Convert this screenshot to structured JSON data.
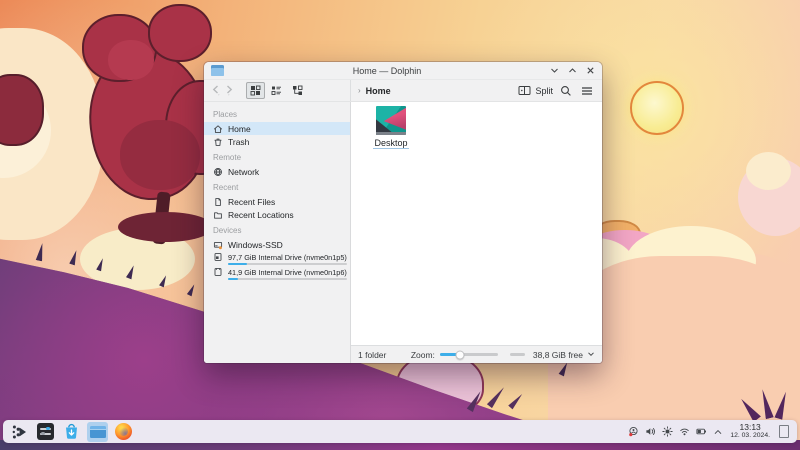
{
  "colors": {
    "accent": "#3daee9",
    "selection_bg": "#d3e7f8",
    "window_chrome": "#f1f1f2",
    "panel_bg": "#ebe8f2",
    "sky_orange": "#ec8a58",
    "hill_purple": "#6c3b78",
    "tree_red": "#a93247"
  },
  "window": {
    "title": "Home — Dolphin",
    "controls": [
      {
        "name": "minimize",
        "glyph": "chevron-down"
      },
      {
        "name": "maximize",
        "glyph": "chevron-up"
      },
      {
        "name": "close",
        "glyph": "x"
      }
    ],
    "toolbar": {
      "back_label": "back",
      "forward_label": "forward",
      "view_modes": [
        "icons-view",
        "details-view",
        "tree-view"
      ],
      "breadcrumb_sep": "›",
      "breadcrumb": "Home",
      "split_label": "Split"
    },
    "sidebar": {
      "sections": [
        {
          "label": "Places",
          "items": [
            {
              "label": "Home",
              "icon": "home-icon",
              "selected": true
            },
            {
              "label": "Trash",
              "icon": "trash-icon"
            }
          ]
        },
        {
          "label": "Remote",
          "items": [
            {
              "label": "Network",
              "icon": "network-icon"
            }
          ]
        },
        {
          "label": "Recent",
          "items": [
            {
              "label": "Recent Files",
              "icon": "recent-files-icon"
            },
            {
              "label": "Recent Locations",
              "icon": "recent-locations-icon"
            }
          ]
        },
        {
          "label": "Devices",
          "items": [
            {
              "label": "Windows-SSD",
              "icon": "windows-drive-icon"
            },
            {
              "label": "97,7 GiB Internal Drive (nvme0n1p5)",
              "icon": "internal-drive-mounted-icon",
              "small": true,
              "usage": 0.16
            },
            {
              "label": "41,9 GiB Internal Drive (nvme0n1p6)",
              "icon": "internal-drive-icon",
              "small": true,
              "usage": 0.08
            }
          ]
        }
      ]
    },
    "content": {
      "items": [
        {
          "label": "Desktop",
          "icon": "desktop-folder-icon"
        }
      ]
    },
    "statusbar": {
      "left": "1 folder",
      "zoom_label": "Zoom:",
      "zoom_value": 0.35,
      "free_space": "38,8 GiB free"
    }
  },
  "taskbar": {
    "launchers": [
      {
        "name": "application-launcher",
        "active": false
      },
      {
        "name": "system-settings",
        "active": false
      },
      {
        "name": "discover",
        "active": false
      },
      {
        "name": "dolphin",
        "active": true
      },
      {
        "name": "firefox",
        "active": false
      }
    ],
    "tray": [
      "user-status-icon",
      "volume-icon",
      "brightness-icon",
      "wifi-icon",
      "battery-icon",
      "expand-tray-icon"
    ],
    "clock": {
      "time": "13:13",
      "date": "12. 03. 2024."
    }
  }
}
